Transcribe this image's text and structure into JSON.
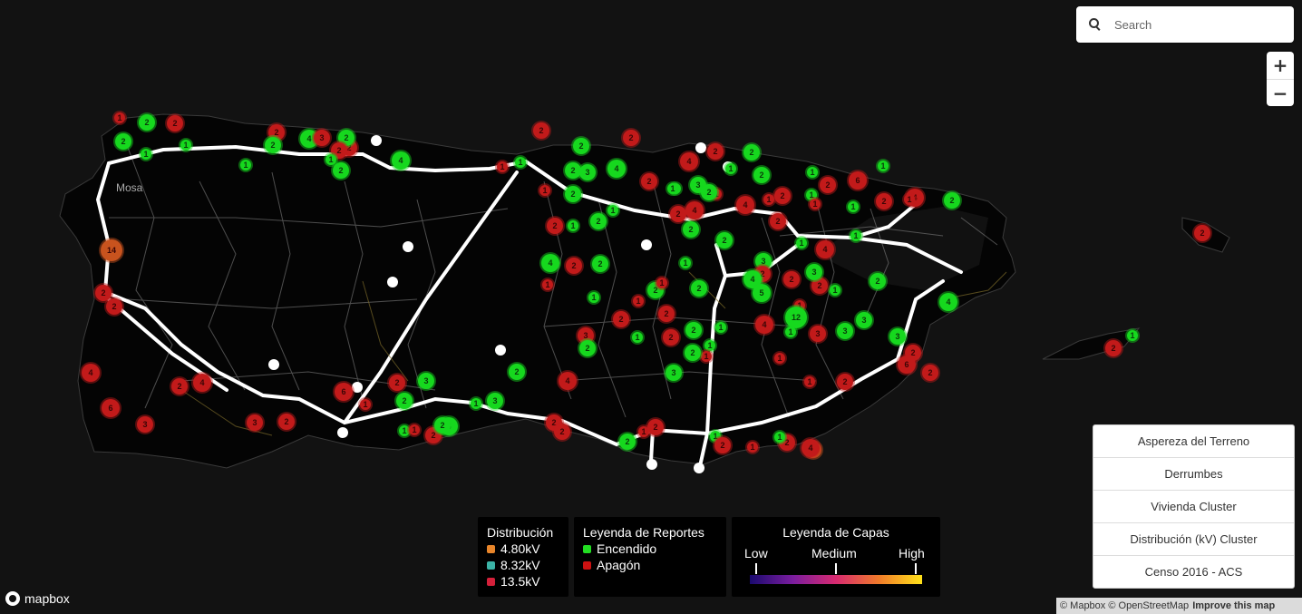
{
  "search": {
    "placeholder": "Search"
  },
  "zoom": {
    "in": "+",
    "out": "−"
  },
  "place_label": "Mosa",
  "layers": [
    "Aspereza del Terreno",
    "Derrumbes",
    "Vivienda Cluster",
    "Distribución (kV) Cluster",
    "Censo 2016 - ACS"
  ],
  "legend_distribucion": {
    "title": "Distribución",
    "items": [
      {
        "label": "4.80kV",
        "color": "#e8852a"
      },
      {
        "label": "8.32kV",
        "color": "#3bb3a6"
      },
      {
        "label": "13.5kV",
        "color": "#d4203a"
      }
    ]
  },
  "legend_reportes": {
    "title": "Leyenda de Reportes",
    "items": [
      {
        "label": "Encendido",
        "color": "#22dd22"
      },
      {
        "label": "Apagón",
        "color": "#cc1111"
      }
    ]
  },
  "legend_capas": {
    "title": "Leyenda de Capas",
    "low": "Low",
    "medium": "Medium",
    "high": "High"
  },
  "mapbox_logo": "mapbox",
  "attribution": {
    "mapbox": "© Mapbox",
    "osm": "© OpenStreetMap",
    "improve": "Improve this map"
  },
  "colors": {
    "green": "#16d81e",
    "red": "#c21a1a",
    "orange": "#c8531e"
  },
  "clusters": [
    {
      "label": "2",
      "color": "red"
    },
    {
      "label": "1",
      "color": "red"
    },
    {
      "label": "2",
      "color": "green"
    },
    {
      "label": "1",
      "color": "green"
    },
    {
      "label": "2",
      "color": "green"
    },
    {
      "label": "2",
      "color": "red"
    },
    {
      "label": "1",
      "color": "green"
    },
    {
      "label": "2",
      "color": "red"
    },
    {
      "label": "2",
      "color": "green"
    },
    {
      "label": "4",
      "color": "green"
    },
    {
      "label": "3",
      "color": "red"
    },
    {
      "label": "2",
      "color": "green"
    },
    {
      "label": "2",
      "color": "red"
    },
    {
      "label": "2",
      "color": "green"
    },
    {
      "label": "1",
      "color": "green"
    },
    {
      "label": "4",
      "color": "green"
    },
    {
      "label": "1",
      "color": "green"
    },
    {
      "label": "2",
      "color": "red"
    },
    {
      "label": "2",
      "color": "green"
    },
    {
      "label": "2",
      "color": "red"
    },
    {
      "label": "1",
      "color": "green"
    },
    {
      "label": "2",
      "color": "green"
    },
    {
      "label": "1",
      "color": "red"
    },
    {
      "label": "3",
      "color": "green"
    },
    {
      "label": "4",
      "color": "green"
    },
    {
      "label": "2",
      "color": "red"
    },
    {
      "label": "1",
      "color": "green"
    },
    {
      "label": "3",
      "color": "green"
    },
    {
      "label": "1",
      "color": "red"
    },
    {
      "label": "2",
      "color": "green"
    },
    {
      "label": "1",
      "color": "green"
    },
    {
      "label": "2",
      "color": "green"
    },
    {
      "label": "1",
      "color": "green"
    },
    {
      "label": "2",
      "color": "red"
    },
    {
      "label": "2",
      "color": "red"
    },
    {
      "label": "2",
      "color": "green"
    },
    {
      "label": "1",
      "color": "green"
    },
    {
      "label": "1",
      "color": "red"
    },
    {
      "label": "4",
      "color": "green"
    },
    {
      "label": "1",
      "color": "red"
    },
    {
      "label": "2",
      "color": "green"
    },
    {
      "label": "2",
      "color": "red"
    },
    {
      "label": "1",
      "color": "green"
    },
    {
      "label": "2",
      "color": "green"
    },
    {
      "label": "1",
      "color": "green"
    },
    {
      "label": "2",
      "color": "green"
    },
    {
      "label": "2",
      "color": "green"
    },
    {
      "label": "4",
      "color": "red"
    },
    {
      "label": "2",
      "color": "red"
    },
    {
      "label": "1",
      "color": "green"
    },
    {
      "label": "1",
      "color": "red"
    },
    {
      "label": "2",
      "color": "green"
    },
    {
      "label": "4",
      "color": "red"
    },
    {
      "label": "2",
      "color": "red"
    },
    {
      "label": "2",
      "color": "green"
    },
    {
      "label": "1",
      "color": "green"
    },
    {
      "label": "2",
      "color": "green"
    },
    {
      "label": "2",
      "color": "red"
    },
    {
      "label": "1",
      "color": "red"
    },
    {
      "label": "4",
      "color": "red"
    },
    {
      "label": "2",
      "color": "red"
    },
    {
      "label": "1",
      "color": "green"
    },
    {
      "label": "1",
      "color": "green"
    },
    {
      "label": "2",
      "color": "red"
    },
    {
      "label": "1",
      "color": "red"
    },
    {
      "label": "1",
      "color": "green"
    },
    {
      "label": "6",
      "color": "red"
    },
    {
      "label": "1",
      "color": "green"
    },
    {
      "label": "4",
      "color": "red"
    },
    {
      "label": "2",
      "color": "green"
    },
    {
      "label": "1",
      "color": "red"
    },
    {
      "label": "2",
      "color": "red"
    },
    {
      "label": "1",
      "color": "green"
    },
    {
      "label": "4",
      "color": "red"
    },
    {
      "label": "1",
      "color": "green"
    },
    {
      "label": "2",
      "color": "green"
    },
    {
      "label": "1",
      "color": "green"
    },
    {
      "label": "2",
      "color": "red"
    },
    {
      "label": "3",
      "color": "green"
    },
    {
      "label": "2",
      "color": "red"
    },
    {
      "label": "3",
      "color": "green"
    },
    {
      "label": "2",
      "color": "red"
    },
    {
      "label": "4",
      "color": "green"
    },
    {
      "label": "5",
      "color": "green"
    },
    {
      "label": "1",
      "color": "red"
    },
    {
      "label": "1",
      "color": "green"
    },
    {
      "label": "4",
      "color": "red"
    },
    {
      "label": "12",
      "color": "green"
    },
    {
      "label": "3",
      "color": "green"
    },
    {
      "label": "3",
      "color": "red"
    },
    {
      "label": "3",
      "color": "green"
    },
    {
      "label": "3",
      "color": "green"
    },
    {
      "label": "2",
      "color": "red"
    },
    {
      "label": "6",
      "color": "red"
    },
    {
      "label": "2",
      "color": "red"
    },
    {
      "label": "4",
      "color": "green"
    },
    {
      "label": "2",
      "color": "red"
    },
    {
      "label": "1",
      "color": "green"
    },
    {
      "label": "2",
      "color": "red"
    },
    {
      "label": "1",
      "color": "red"
    },
    {
      "label": "1",
      "color": "red"
    },
    {
      "label": "2",
      "color": "red"
    },
    {
      "label": "2",
      "color": "orange"
    },
    {
      "label": "2",
      "color": "red"
    },
    {
      "label": "1",
      "color": "green"
    },
    {
      "label": "1",
      "color": "red"
    },
    {
      "label": "2",
      "color": "green"
    },
    {
      "label": "3",
      "color": "green"
    },
    {
      "label": "2",
      "color": "green"
    },
    {
      "label": "1",
      "color": "green"
    },
    {
      "label": "2",
      "color": "red"
    },
    {
      "label": "1",
      "color": "red"
    },
    {
      "label": "3",
      "color": "red"
    },
    {
      "label": "2",
      "color": "green"
    },
    {
      "label": "2",
      "color": "red"
    },
    {
      "label": "4",
      "color": "red"
    },
    {
      "label": "2",
      "color": "green"
    },
    {
      "label": "1",
      "color": "green"
    },
    {
      "label": "3",
      "color": "green"
    },
    {
      "label": "2",
      "color": "green"
    },
    {
      "label": "2",
      "color": "red"
    },
    {
      "label": "3",
      "color": "green"
    },
    {
      "label": "1",
      "color": "red"
    },
    {
      "label": "6",
      "color": "red"
    },
    {
      "label": "1",
      "color": "green"
    },
    {
      "label": "1",
      "color": "red"
    },
    {
      "label": "2",
      "color": "red"
    },
    {
      "label": "4",
      "color": "green"
    },
    {
      "label": "2",
      "color": "green"
    },
    {
      "label": "2",
      "color": "red"
    },
    {
      "label": "2",
      "color": "red"
    },
    {
      "label": "2",
      "color": "green"
    },
    {
      "label": "1",
      "color": "red"
    },
    {
      "label": "2",
      "color": "red"
    },
    {
      "label": "1",
      "color": "green"
    },
    {
      "label": "2",
      "color": "red"
    },
    {
      "label": "1",
      "color": "red"
    },
    {
      "label": "1",
      "color": "green"
    },
    {
      "label": "4",
      "color": "red"
    },
    {
      "label": "14",
      "color": "orange"
    },
    {
      "label": "2",
      "color": "red"
    },
    {
      "label": "2",
      "color": "red"
    },
    {
      "label": "4",
      "color": "red"
    },
    {
      "label": "6",
      "color": "red"
    },
    {
      "label": "3",
      "color": "red"
    },
    {
      "label": "2",
      "color": "red"
    },
    {
      "label": "4",
      "color": "red"
    },
    {
      "label": "3",
      "color": "red"
    },
    {
      "label": "2",
      "color": "red"
    }
  ]
}
